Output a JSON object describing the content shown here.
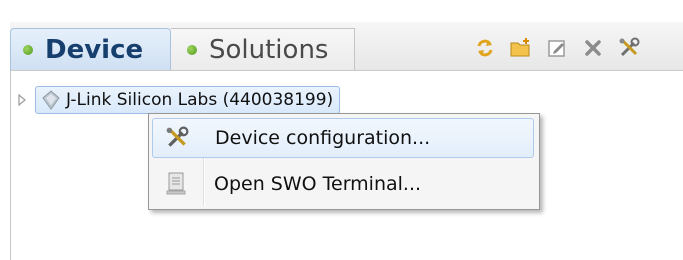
{
  "tabs": [
    {
      "label": "Device",
      "active": true
    },
    {
      "label": "Solutions",
      "active": false
    }
  ],
  "toolbar": {
    "icons": [
      "refresh-icon",
      "new-folder-icon",
      "edit-icon",
      "delete-icon",
      "tools-icon"
    ]
  },
  "tree": {
    "node_label": "J-Link Silicon Labs (440038199)",
    "node_icon": "device-icon",
    "expanded": false
  },
  "context_menu": {
    "items": [
      {
        "label": "Device configuration...",
        "icon": "tools-icon",
        "highlighted": true
      },
      {
        "label": "Open SWO Terminal...",
        "icon": "terminal-icon",
        "highlighted": false
      }
    ]
  },
  "colors": {
    "active_tab_text": "#173f6e",
    "status_dot": "#6cb33f",
    "selection_border": "#9dbde4"
  }
}
